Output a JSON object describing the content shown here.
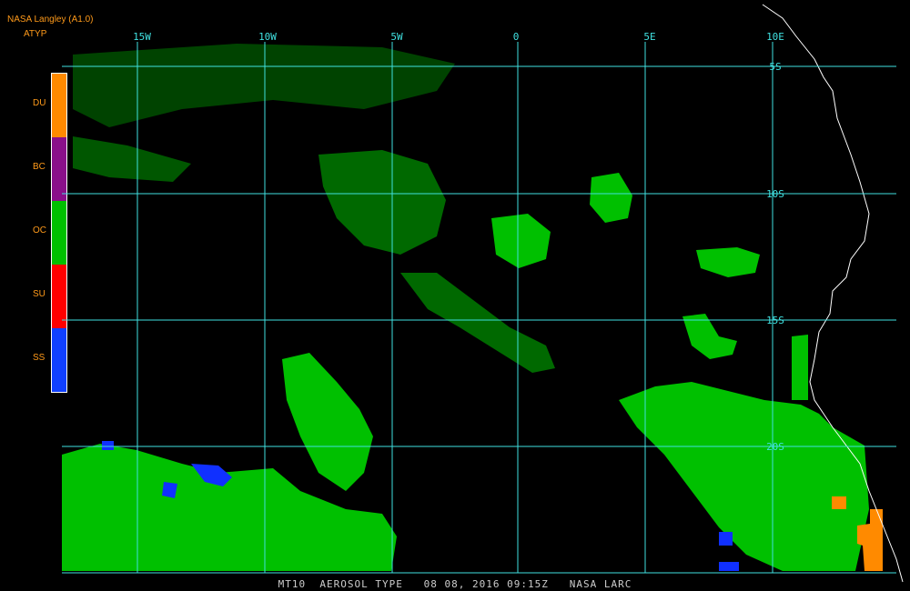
{
  "header": {
    "source": "NASA Langley (A1.0)",
    "product": "ATYP"
  },
  "legend": [
    {
      "code": "DU",
      "color": "#ff8a00"
    },
    {
      "code": "BC",
      "color": "#8a0f8a"
    },
    {
      "code": "OC",
      "color": "#00c000"
    },
    {
      "code": "SU",
      "color": "#ff0000"
    },
    {
      "code": "SS",
      "color": "#1040ff"
    }
  ],
  "map": {
    "lon_labels": [
      "15W",
      "10W",
      "5W",
      "0",
      "5E",
      "10E"
    ],
    "lat_labels": [
      "5S",
      "10S",
      "15S",
      "20S"
    ],
    "grid_color": "#40e0e0",
    "coast_color": "#ffffff"
  },
  "footer": {
    "text": "MT10  AEROSOL TYPE   08 08, 2016 09:15Z   NASA LARC"
  }
}
